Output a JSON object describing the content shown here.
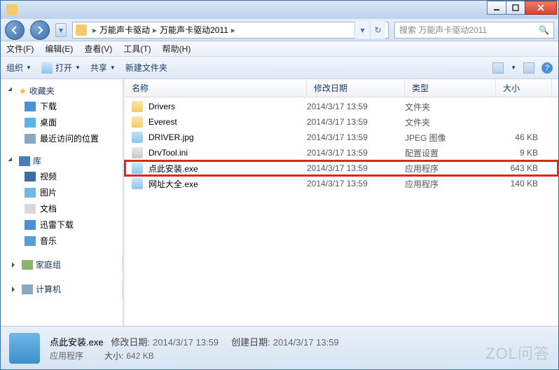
{
  "titlebar": {
    "title": ""
  },
  "nav": {
    "breadcrumb": [
      "万能声卡驱动",
      "万能声卡驱动2011"
    ],
    "search_placeholder": "搜索 万能声卡驱动2011"
  },
  "menu": {
    "file": "文件(F)",
    "edit": "编辑(E)",
    "view": "查看(V)",
    "tools": "工具(T)",
    "help": "帮助(H)"
  },
  "toolbar": {
    "org": "组织",
    "open": "打开",
    "share": "共享",
    "newfolder": "新建文件夹"
  },
  "sidebar": {
    "fav": {
      "label": "收藏夹",
      "items": [
        "下载",
        "桌面",
        "最近访问的位置"
      ]
    },
    "lib": {
      "label": "库",
      "items": [
        "视频",
        "图片",
        "文档",
        "迅雷下载",
        "音乐"
      ]
    },
    "home": {
      "label": "家庭组"
    },
    "comp": {
      "label": "计算机"
    }
  },
  "columns": {
    "name": "名称",
    "date": "修改日期",
    "type": "类型",
    "size": "大小"
  },
  "files": [
    {
      "name": "Drivers",
      "date": "2014/3/17 13:59",
      "type": "文件夹",
      "size": "",
      "icon": "foldicon",
      "hl": false
    },
    {
      "name": "Everest",
      "date": "2014/3/17 13:59",
      "type": "文件夹",
      "size": "",
      "icon": "foldicon",
      "hl": false
    },
    {
      "name": "DRIVER.jpg",
      "date": "2014/3/17 13:59",
      "type": "JPEG 图像",
      "size": "46 KB",
      "icon": "imgicon",
      "hl": false
    },
    {
      "name": "DrvTool.ini",
      "date": "2014/3/17 13:59",
      "type": "配置设置",
      "size": "9 KB",
      "icon": "cfgicon",
      "hl": false
    },
    {
      "name": "点此安装.exe",
      "date": "2014/3/17 13:59",
      "type": "应用程序",
      "size": "643 KB",
      "icon": "exeicon",
      "hl": true
    },
    {
      "name": "网址大全.exe",
      "date": "2014/3/17 13:59",
      "type": "应用程序",
      "size": "140 KB",
      "icon": "exeicon",
      "hl": false
    }
  ],
  "status": {
    "title": "点此安装.exe",
    "subtitle": "应用程序",
    "mod_label": "修改日期:",
    "mod_value": "2014/3/17 13:59",
    "size_label": "大小:",
    "size_value": "642 KB",
    "create_label": "创建日期:",
    "create_value": "2014/3/17 13:59"
  },
  "watermark": "ZOL问答"
}
